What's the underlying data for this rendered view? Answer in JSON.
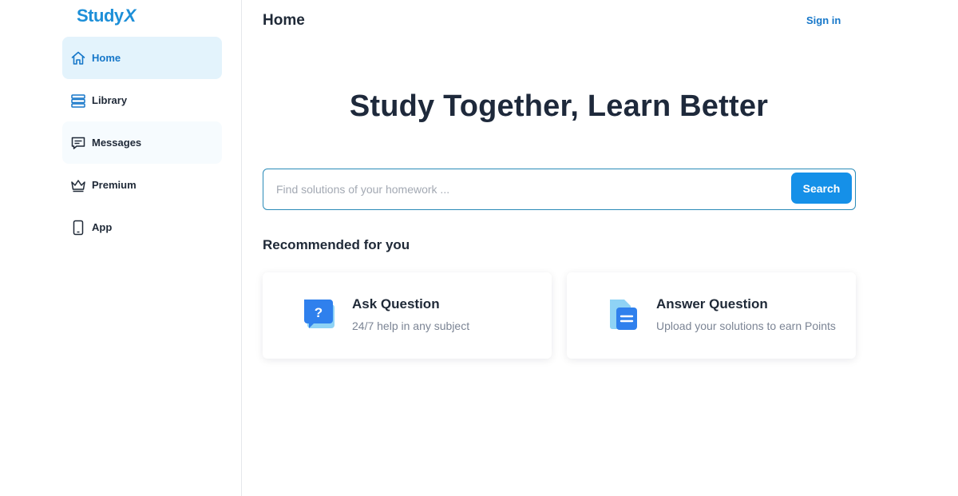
{
  "logo": {
    "text": "Study",
    "accent": "X"
  },
  "sidebar": {
    "items": [
      {
        "label": "Home",
        "icon": "home-icon",
        "state": "active"
      },
      {
        "label": "Library",
        "icon": "library-icon",
        "state": "normal"
      },
      {
        "label": "Messages",
        "icon": "messages-icon",
        "state": "hover"
      },
      {
        "label": "Premium",
        "icon": "crown-icon",
        "state": "normal"
      },
      {
        "label": "App",
        "icon": "phone-icon",
        "state": "normal"
      }
    ]
  },
  "header": {
    "title": "Home",
    "signin_label": "Sign in"
  },
  "hero": {
    "headline": "Study Together, Learn Better"
  },
  "search": {
    "placeholder": "Find solutions of your homework ...",
    "value": "",
    "button_label": "Search"
  },
  "recommended": {
    "title": "Recommended for you",
    "cards": [
      {
        "title": "Ask Question",
        "subtitle": "24/7 help in any subject",
        "icon": "question-bubble-icon"
      },
      {
        "title": "Answer Question",
        "subtitle": "Upload your solutions to earn Points",
        "icon": "document-icon"
      }
    ]
  },
  "colors": {
    "accent": "#1590e8",
    "link": "#1677c9",
    "active_bg": "#e3f3fc",
    "text": "#1f2937",
    "muted": "#7b8494"
  }
}
